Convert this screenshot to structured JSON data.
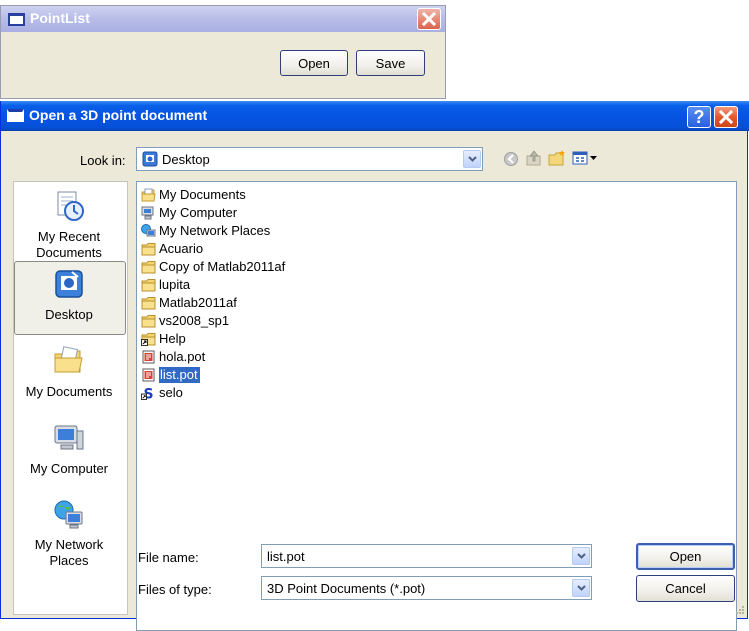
{
  "pointlist_window": {
    "title": "PointList",
    "open_label": "Open",
    "save_label": "Save"
  },
  "dialog": {
    "title": "Open a 3D point document",
    "look_in_label": "Look in:",
    "look_in_value": "Desktop",
    "places": [
      {
        "label_line1": "My Recent",
        "label_line2": "Documents"
      },
      {
        "label_line1": "Desktop",
        "label_line2": ""
      },
      {
        "label_line1": "My Documents",
        "label_line2": ""
      },
      {
        "label_line1": "My Computer",
        "label_line2": ""
      },
      {
        "label_line1": "My Network",
        "label_line2": "Places"
      }
    ],
    "files": [
      {
        "name": "My Documents",
        "icon": "my-documents-icon"
      },
      {
        "name": "My Computer",
        "icon": "my-computer-icon"
      },
      {
        "name": "My Network Places",
        "icon": "network-places-icon"
      },
      {
        "name": "Acuario",
        "icon": "folder-icon"
      },
      {
        "name": "Copy of Matlab2011af",
        "icon": "folder-icon"
      },
      {
        "name": "lupita",
        "icon": "folder-icon"
      },
      {
        "name": "Matlab2011af",
        "icon": "folder-icon"
      },
      {
        "name": "vs2008_sp1",
        "icon": "folder-icon"
      },
      {
        "name": "Help",
        "icon": "shortcut-icon"
      },
      {
        "name": "hola.pot",
        "icon": "pot-file-icon"
      },
      {
        "name": "list.pot",
        "icon": "pot-file-icon"
      },
      {
        "name": "selo",
        "icon": "s-shortcut-icon"
      }
    ],
    "selected_file": "list.pot",
    "file_name_label": "File name:",
    "file_name_value": "list.pot",
    "files_of_type_label": "Files of type:",
    "files_of_type_value": "3D Point Documents (*.pot)",
    "open_label": "Open",
    "cancel_label": "Cancel",
    "help_glyph": "?"
  },
  "colors": {
    "selection": "#316ac5",
    "titlebar_active": "#0554e3",
    "titlebar_inactive": "#b9bee8",
    "close_red": "#e0532e",
    "dialog_face": "#ece9d8"
  }
}
